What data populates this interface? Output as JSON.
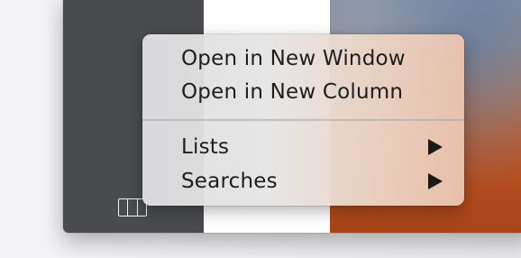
{
  "context_menu": {
    "items": [
      {
        "label": "Open in New Window",
        "has_submenu": false
      },
      {
        "label": "Open in New Column",
        "has_submenu": false
      },
      {
        "label": "Lists",
        "has_submenu": true
      },
      {
        "label": "Searches",
        "has_submenu": true
      }
    ]
  },
  "icons": {
    "view_toggle": "column-view-icon",
    "submenu": "chevron-right-triangle-icon"
  },
  "colors": {
    "sidebar": "#4a4b4e",
    "menu_text": "#1e1e1e"
  }
}
